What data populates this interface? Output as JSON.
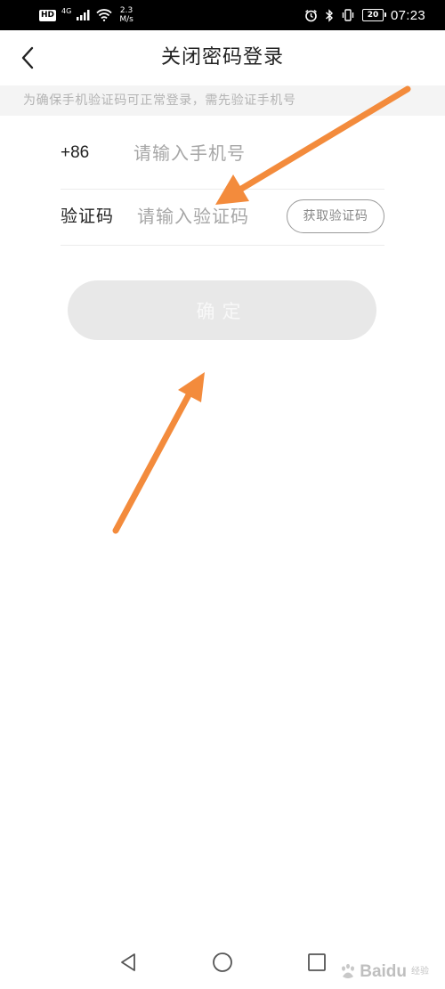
{
  "status_bar": {
    "hd": "HD",
    "network": "4G",
    "speed_value": "2.3",
    "speed_unit": "M/s",
    "battery": "20",
    "time": "07:23",
    "icons": [
      "signal-icon",
      "wifi-icon",
      "alarm-icon",
      "bluetooth-icon",
      "vibrate-icon",
      "battery-icon"
    ]
  },
  "header": {
    "title": "关闭密码登录",
    "back_icon": "chevron-left-icon"
  },
  "notice": "为确保手机验证码可正常登录，需先验证手机号",
  "form": {
    "country_code": "+86",
    "phone_placeholder": "请输入手机号",
    "phone_value": "",
    "code_label": "验证码",
    "code_placeholder": "请输入验证码",
    "code_value": "",
    "get_code_label": "获取验证码"
  },
  "confirm_label": "确定",
  "annotation": {
    "arrow_color": "#f38b3c"
  },
  "nav": {
    "back": "triangle-back-icon",
    "home": "circle-home-icon",
    "recent": "square-recent-icon"
  },
  "watermark": {
    "brand": "Baidu",
    "sub": "经验"
  },
  "colors": {
    "title": "#222222",
    "placeholder": "#a6a6a6",
    "notice_bg": "#f4f4f4",
    "notice_text": "#b3b3b3",
    "button_disabled": "#e8e8e8"
  }
}
